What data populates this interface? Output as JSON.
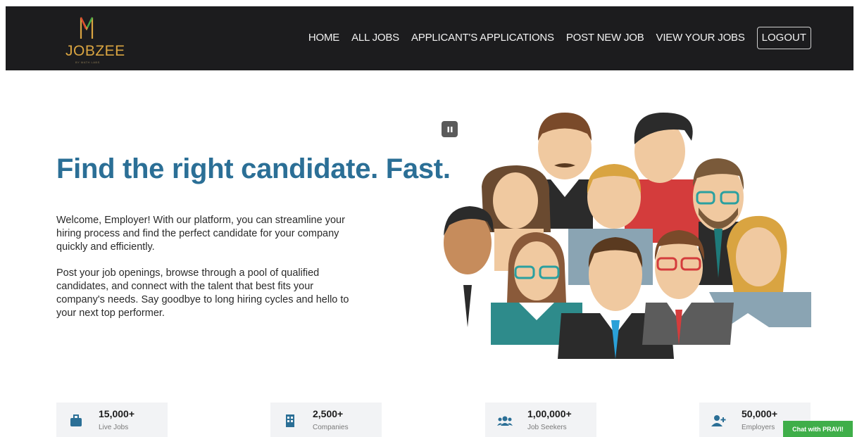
{
  "brand": {
    "name": "JOBZEE",
    "tagline": "BY MATH LABS",
    "logo_color": "#d9a441"
  },
  "nav": {
    "links": [
      "HOME",
      "ALL JOBS",
      "APPLICANT'S APPLICATIONS",
      "POST NEW JOB",
      "VIEW YOUR JOBS"
    ],
    "logout_label": "LOGOUT"
  },
  "hero": {
    "title": "Find the right candidate. Fast.",
    "paragraph1": "Welcome, Employer! With our platform, you can streamline your hiring process and find the perfect candidate for your company quickly and efficiently.",
    "paragraph2": "Post your job openings, browse through a pool of qualified candidates, and connect with the talent that best fits your company's needs. Say goodbye to long hiring cycles and hello to your next top performer.",
    "title_color": "#2b6f96"
  },
  "stats": [
    {
      "value": "15,000+",
      "label": "Live Jobs",
      "icon": "briefcase-icon"
    },
    {
      "value": "2,500+",
      "label": "Companies",
      "icon": "building-icon"
    },
    {
      "value": "1,00,000+",
      "label": "Job Seekers",
      "icon": "users-icon"
    },
    {
      "value": "50,000+",
      "label": "Employers",
      "icon": "user-plus-icon"
    }
  ],
  "chat": {
    "label": "Chat with PRAVI!",
    "color": "#3fae49"
  },
  "icons": {
    "pause": "pause-icon"
  },
  "colors": {
    "navbar": "#1c1c1e",
    "icon_accent": "#2b6f96"
  }
}
